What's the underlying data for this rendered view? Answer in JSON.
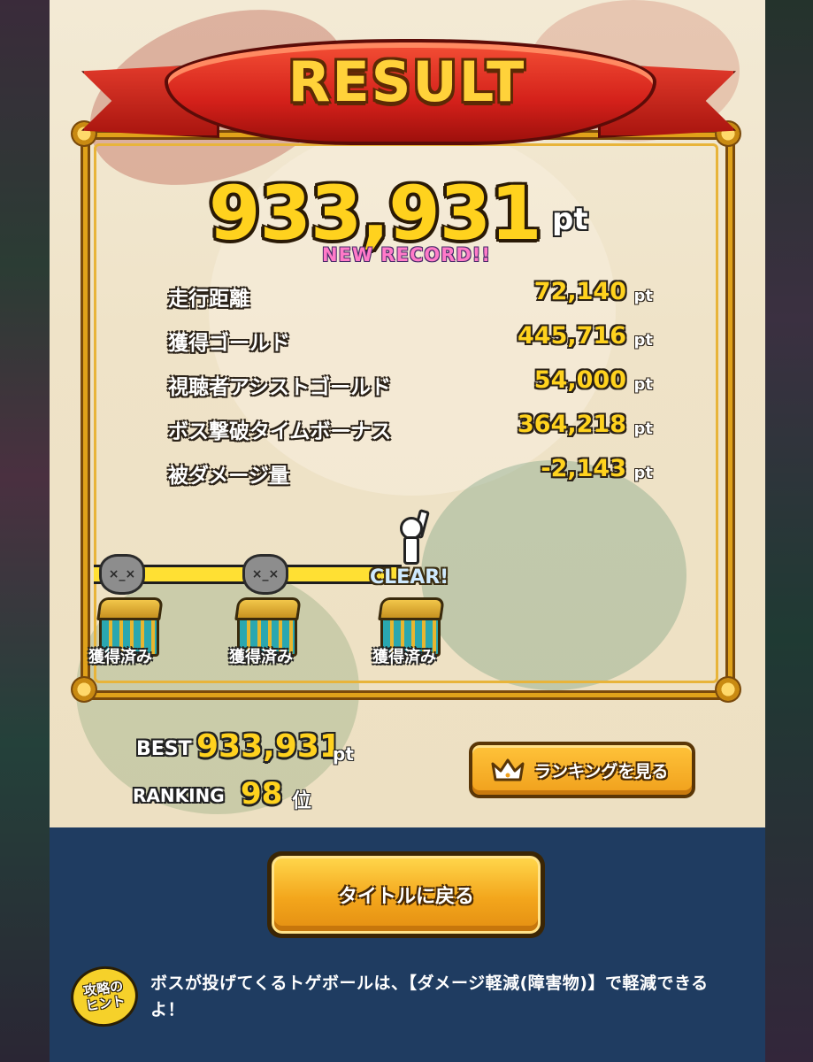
{
  "result": {
    "title": "RESULT",
    "score": "933,931",
    "score_unit": "pt",
    "new_record": "NEW RECORD!!"
  },
  "breakdown": [
    {
      "label": "走行距離",
      "value": "72,140",
      "unit": "pt"
    },
    {
      "label": "獲得ゴールド",
      "value": "445,716",
      "unit": "pt"
    },
    {
      "label": "視聴者アシストゴールド",
      "value": "54,000",
      "unit": "pt"
    },
    {
      "label": "ボス撃破タイムボーナス",
      "value": "364,218",
      "unit": "pt"
    },
    {
      "label": "被ダメージ量",
      "value": "-2,143",
      "unit": "pt"
    }
  ],
  "progress": {
    "clear_label": "CLEAR!",
    "chests": [
      {
        "label": "獲得済み",
        "icon": "treasure-chest-icon"
      },
      {
        "label": "獲得済み",
        "icon": "treasure-chest-icon"
      },
      {
        "label": "獲得済み",
        "icon": "treasure-chest-icon"
      }
    ],
    "bosses": [
      "boss-icon",
      "boss-icon"
    ]
  },
  "best": {
    "label": "BEST",
    "value": "933,931",
    "unit": "pt"
  },
  "ranking": {
    "label": "RANKING",
    "value": "98",
    "unit": "位",
    "button_label": "ランキングを見る",
    "button_icon": "crown-icon"
  },
  "actions": {
    "title_button_label": "タイトルに戻る"
  },
  "hint": {
    "badge_line1": "攻略の",
    "badge_line2": "ヒント",
    "text": "ボスが投げてくるトゲボールは、【ダメージ軽減(障害物)】で軽減できるよ！"
  },
  "colors": {
    "score_yellow": "#ffd21e",
    "button_orange": "#f0a01c",
    "footer_navy": "#1f3c61",
    "ribbon_red": "#d3201a",
    "frame_gold": "#e0a21a"
  }
}
